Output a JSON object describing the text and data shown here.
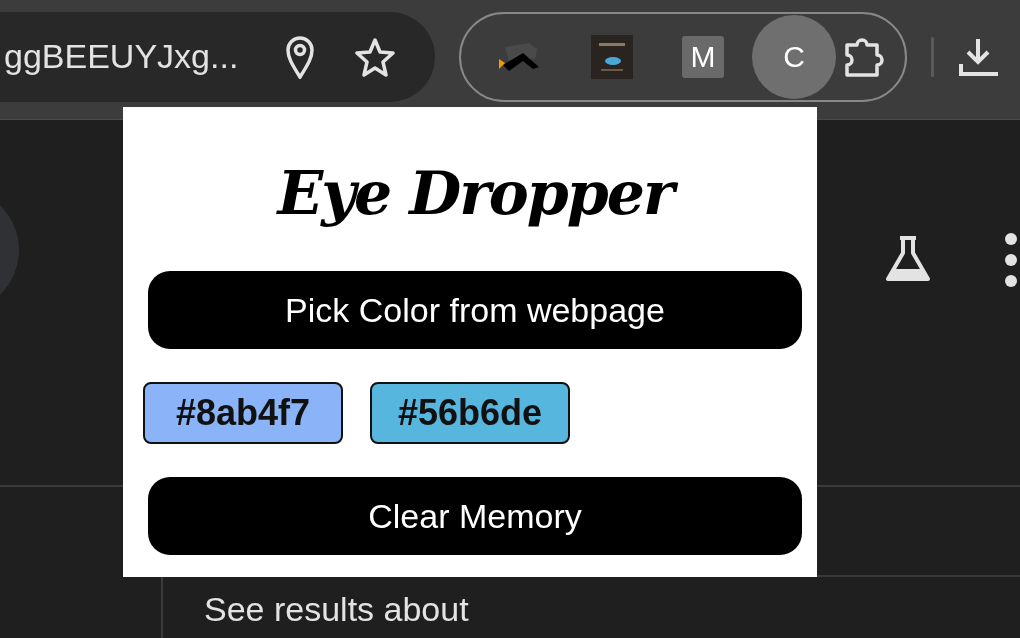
{
  "address_bar": {
    "url": "ggBEEUYJxg..."
  },
  "extensions": [
    {
      "kind": "image",
      "selected": false
    },
    {
      "kind": "image",
      "selected": false
    },
    {
      "kind": "letter",
      "label": "M",
      "selected": false
    },
    {
      "kind": "round",
      "label": "C",
      "selected": true
    }
  ],
  "popup": {
    "title": "Eye Dropper",
    "pick_button": "Pick Color from webpage",
    "swatches": [
      {
        "text": "#8ab4f7",
        "color": "#8ab4f7"
      },
      {
        "text": "#56b6de",
        "color": "#56b6de"
      }
    ],
    "clear_button": "Clear Memory"
  },
  "page": {
    "heading": "See results about"
  }
}
